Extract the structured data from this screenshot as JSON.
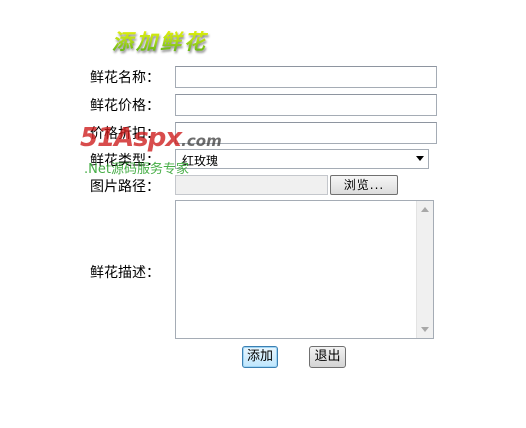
{
  "form": {
    "title": "添加鲜花",
    "name_label": "鲜花名称：",
    "price_label": "鲜花价格：",
    "discount_label": "价格折扣：",
    "type_label": "鲜花类型：",
    "type_value": "红玫瑰",
    "image_label": "图片路径：",
    "browse_label": "浏览...",
    "desc_label": "鲜花描述：",
    "add_button": "添加",
    "quit_button": "退出"
  },
  "watermark": {
    "brand_main": "51Aspx",
    "brand_domain": ".com",
    "slogan": ".Net源码服务专家"
  },
  "colors": {
    "title_gradient_top": "#f7f700",
    "title_gradient_bottom": "#48a61a",
    "watermark_red": "#cd1919",
    "watermark_green": "#28a028"
  }
}
